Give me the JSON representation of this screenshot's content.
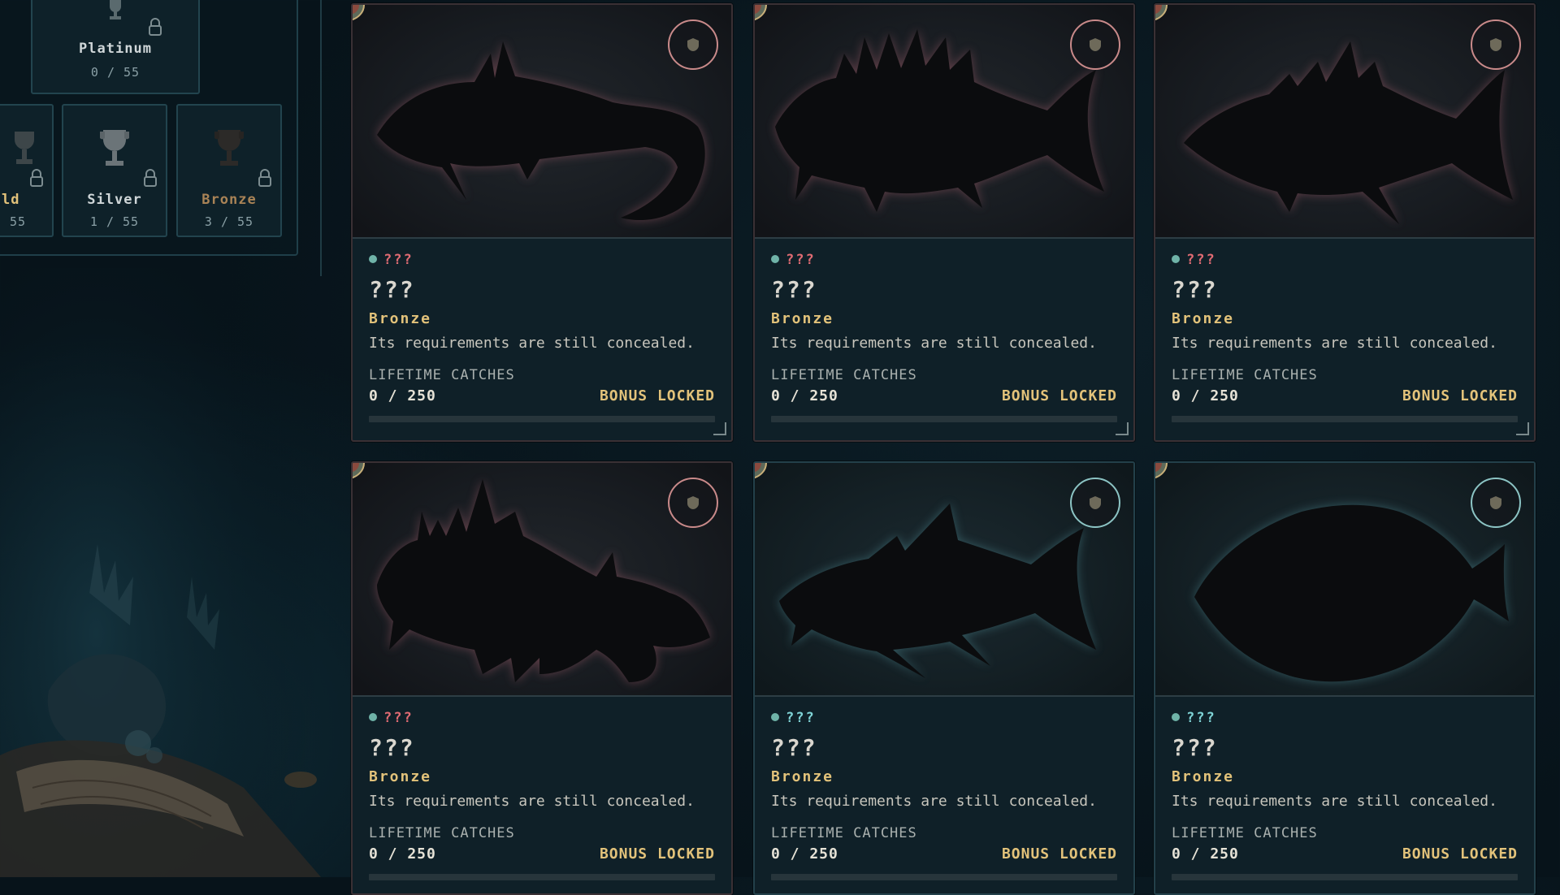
{
  "tiers": [
    {
      "id": "platinum",
      "name": "Platinum",
      "count": "0 / 55",
      "color": "#cfd6d8"
    },
    {
      "id": "gold",
      "name": "ld",
      "count": "55",
      "color": "#e2c27a"
    },
    {
      "id": "silver",
      "name": "Silver",
      "count": "1 / 55",
      "color": "#cfd6d8"
    },
    {
      "id": "bronze",
      "name": "Bronze",
      "count": "3 / 55",
      "color": "#b48a5a"
    }
  ],
  "cards": [
    {
      "location": "???",
      "name": "???",
      "tier": "Bronze",
      "description": "Its requirements are still concealed.",
      "catches_label": "LIFETIME CATCHES",
      "catches": "0 / 250",
      "progress": 0,
      "bonus": "BONUS LOCKED",
      "theme": "pink"
    },
    {
      "location": "???",
      "name": "???",
      "tier": "Bronze",
      "description": "Its requirements are still concealed.",
      "catches_label": "LIFETIME CATCHES",
      "catches": "0 / 250",
      "progress": 0,
      "bonus": "BONUS LOCKED",
      "theme": "pink"
    },
    {
      "location": "???",
      "name": "???",
      "tier": "Bronze",
      "description": "Its requirements are still concealed.",
      "catches_label": "LIFETIME CATCHES",
      "catches": "0 / 250",
      "progress": 0,
      "bonus": "BONUS LOCKED",
      "theme": "pink"
    },
    {
      "location": "???",
      "name": "???",
      "tier": "Bronze",
      "description": "Its requirements are still concealed.",
      "catches_label": "LIFETIME CATCHES",
      "catches": "0 / 250",
      "progress": 0,
      "bonus": "BONUS LOCKED",
      "theme": "pink"
    },
    {
      "location": "???",
      "name": "???",
      "tier": "Bronze",
      "description": "Its requirements are still concealed.",
      "catches_label": "LIFETIME CATCHES",
      "catches": "0 / 250",
      "progress": 0,
      "bonus": "BONUS LOCKED",
      "theme": "teal"
    },
    {
      "location": "???",
      "name": "???",
      "tier": "Bronze",
      "description": "Its requirements are still concealed.",
      "catches_label": "LIFETIME CATCHES",
      "catches": "0 / 250",
      "progress": 0,
      "bonus": "BONUS LOCKED",
      "theme": "teal"
    }
  ],
  "colors": {
    "accent_gold": "#e2c27a",
    "locked_pink": "#e06b73",
    "teal": "#7fd3d6"
  }
}
